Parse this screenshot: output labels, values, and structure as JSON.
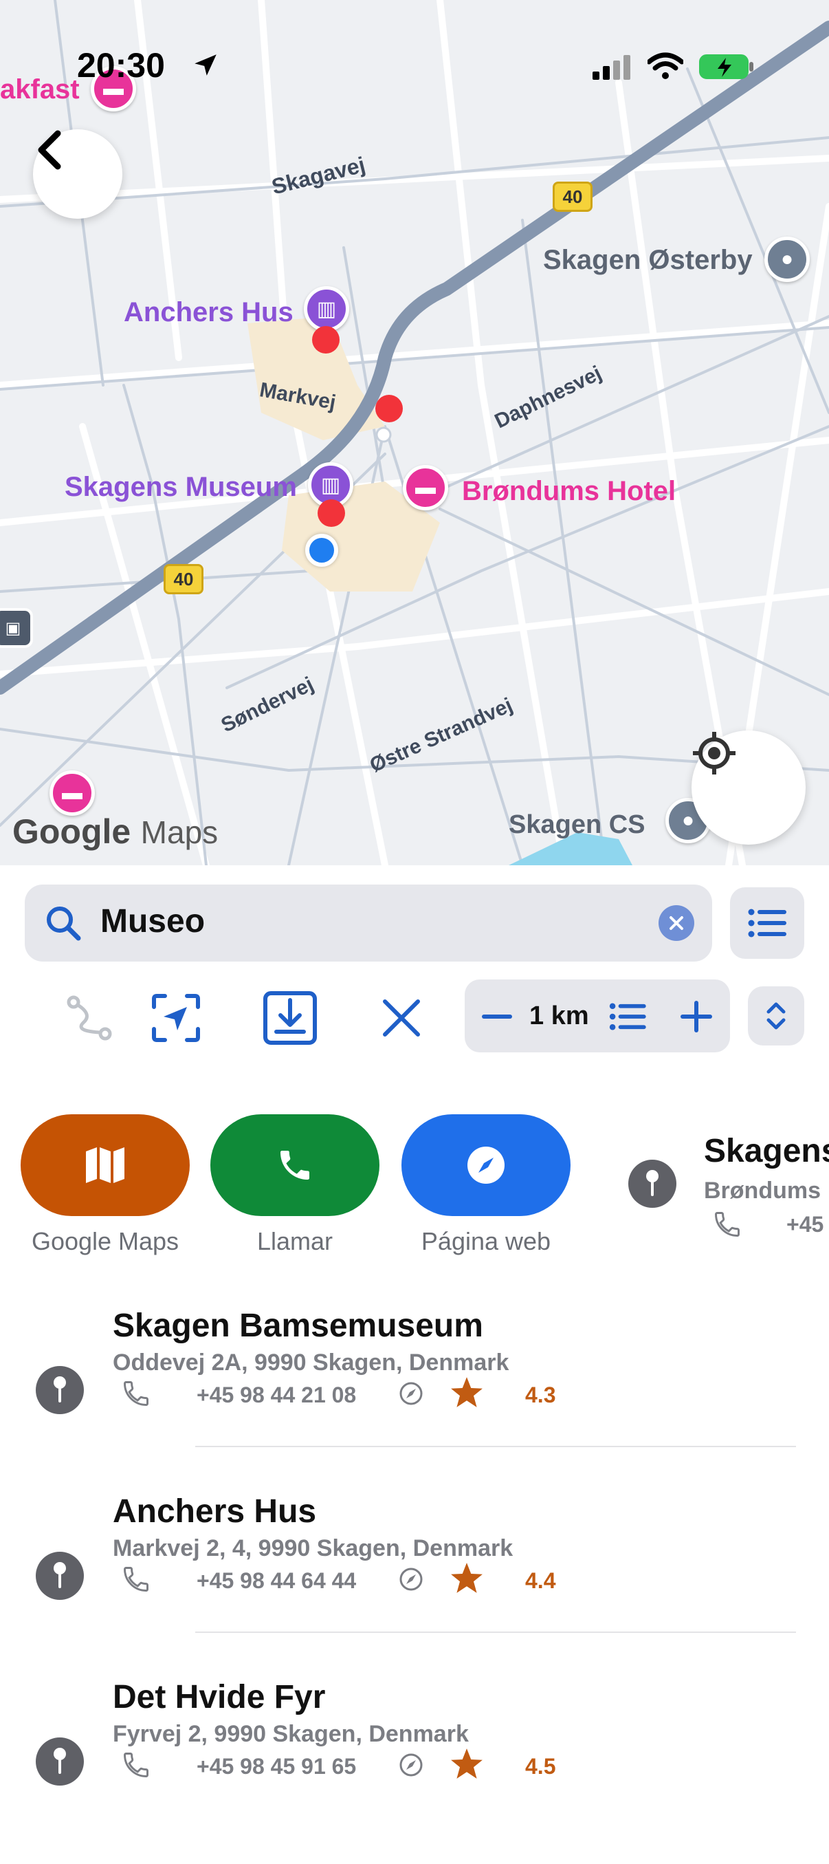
{
  "status_bar": {
    "time": "20:30"
  },
  "map": {
    "places": {
      "breakfast_partial": "akfast",
      "anchers_hus": "Anchers Hus",
      "skagens_museum": "Skagens Museum",
      "brondums_hotel": "Brøndums Hotel",
      "skagen_osterby": "Skagen Østerby",
      "skagen_cs": "Skagen CS"
    },
    "roads": {
      "skagavej": "Skagavej",
      "markvej": "Markvej",
      "daphnesvej": "Daphnesvej",
      "sondervej": "Søndervej",
      "ostre_strandvej": "Østre Strandvej"
    },
    "route_number": "40",
    "watermark_google": "Google",
    "watermark_maps": "Maps"
  },
  "search": {
    "value": "Museo"
  },
  "toolbar": {
    "radius": "1 km"
  },
  "actions": [
    {
      "label": "Google Maps",
      "color": "#c55304"
    },
    {
      "label": "Llamar",
      "color": "#0f8a38"
    },
    {
      "label": "Página web",
      "color": "#1f6fea"
    }
  ],
  "carousel_peek": {
    "title": "Skagens",
    "subtitle": "Brøndums",
    "phone": "+45"
  },
  "results": [
    {
      "title": "Skagen Bamsemuseum",
      "address": "Oddevej 2A, 9990 Skagen, Denmark",
      "phone": "+45 98 44 21 08",
      "rating": "4.3"
    },
    {
      "title": "Anchers Hus",
      "address": "Markvej 2, 4, 9990 Skagen, Denmark",
      "phone": "+45 98 44 64 44",
      "rating": "4.4"
    },
    {
      "title": "Det Hvide Fyr",
      "address": "Fyrvej 2, 9990 Skagen, Denmark",
      "phone": "+45 98 45 91 65",
      "rating": "4.5"
    }
  ],
  "colors": {
    "accent": "#1f5fc8",
    "museum": "#8a52d6",
    "hotel": "#e8339a",
    "map_road": "#8fa3bd"
  }
}
